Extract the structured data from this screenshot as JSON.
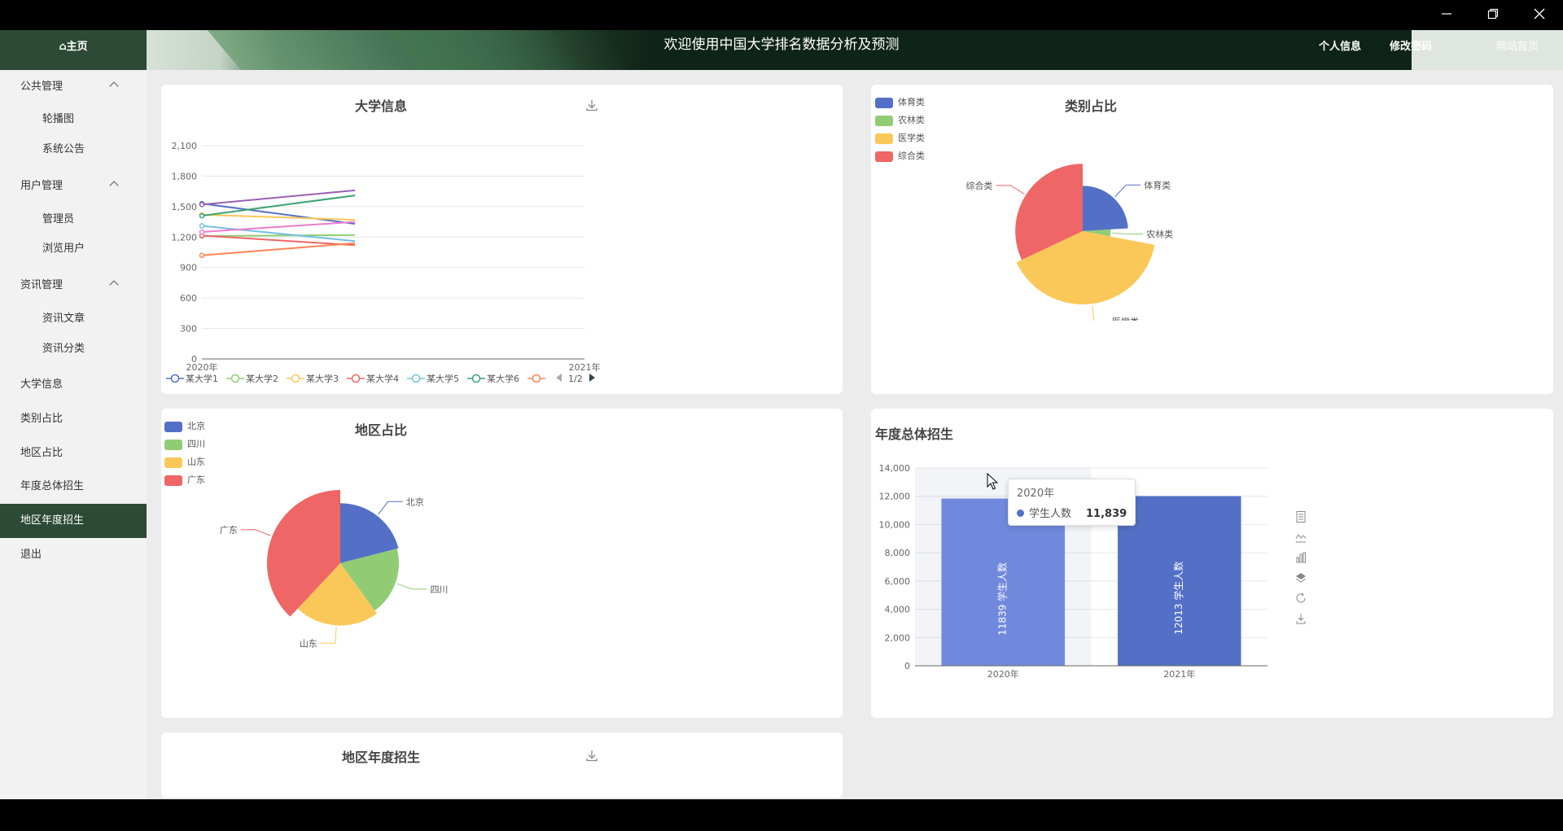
{
  "window": {
    "minimize_icon": "minimize-icon",
    "restore_icon": "restore-icon",
    "close_icon": "close-icon"
  },
  "header": {
    "home_label": "⌂主页",
    "title": "欢迎使用中国大学排名数据分析及预测",
    "links": [
      "个人信息",
      "修改密码",
      "网站首页"
    ]
  },
  "sidebar": {
    "groups": [
      {
        "label": "公共管理",
        "items": [
          "轮播图",
          "系统公告"
        ]
      },
      {
        "label": "用户管理",
        "items": [
          "管理员",
          "浏览用户"
        ]
      },
      {
        "label": "资讯管理",
        "items": [
          "资讯文章",
          "资讯分类"
        ]
      }
    ],
    "items": [
      "大学信息",
      "类别占比",
      "地区占比",
      "年度总体招生",
      "地区年度招生",
      "退出"
    ],
    "active": "地区年度招生"
  },
  "colors": {
    "brand": "#2d4a36",
    "blue": "#5470c6",
    "green": "#91cc75",
    "yellow": "#fac858",
    "red": "#ee6666",
    "cyan": "#73c0de",
    "teal": "#3ba272",
    "orange": "#fc8452",
    "purple": "#9a60b4",
    "pink": "#ea7ccc"
  },
  "cards": {
    "university": {
      "title": "大学信息",
      "pager": "1/2"
    },
    "category": {
      "title": "类别占比"
    },
    "region": {
      "title": "地区占比"
    },
    "enroll": {
      "title": "年度总体招生"
    },
    "region_enroll": {
      "title": "地区年度招生"
    }
  },
  "tooltip": {
    "title": "2020年",
    "series": "学生人数",
    "value": "11,839"
  },
  "chart_data": [
    {
      "id": "university_line",
      "type": "line",
      "title": "大学信息",
      "x": [
        "2020年",
        "2021年"
      ],
      "ylim": [
        0,
        2100
      ],
      "yticks": [
        "0",
        "300",
        "600",
        "900",
        "1,200",
        "1,500",
        "1,800",
        "2,100"
      ],
      "series": [
        {
          "name": "某大学1",
          "color": "#5470c6",
          "values": [
            1530,
            1330
          ]
        },
        {
          "name": "某大学2",
          "color": "#91cc75",
          "values": [
            1210,
            1220
          ]
        },
        {
          "name": "某大学3",
          "color": "#fac858",
          "values": [
            1420,
            1370
          ]
        },
        {
          "name": "某大学4",
          "color": "#ee6666",
          "values": [
            1215,
            1120
          ]
        },
        {
          "name": "某大学5",
          "color": "#73c0de",
          "values": [
            1310,
            1160
          ]
        },
        {
          "name": "某大学6",
          "color": "#3ba272",
          "values": [
            1410,
            1610
          ]
        },
        {
          "name": "",
          "color": "#fc8452",
          "values": [
            1020,
            1140
          ]
        },
        {
          "name": "",
          "color": "#9a60b4",
          "values": [
            1520,
            1660
          ]
        },
        {
          "name": "",
          "color": "#ea7ccc",
          "values": [
            1250,
            1350
          ]
        }
      ],
      "legend_visible_count": 7
    },
    {
      "id": "category_pie",
      "type": "pie",
      "title": "类别占比",
      "categories": [
        "体育类",
        "农林类",
        "医学类",
        "综合类"
      ],
      "values": [
        24,
        4,
        40,
        32
      ],
      "radii": [
        0.62,
        0.38,
        1.0,
        0.92
      ],
      "colors": [
        "#5470c6",
        "#91cc75",
        "#fac858",
        "#ee6666"
      ]
    },
    {
      "id": "region_pie",
      "type": "pie",
      "title": "地区占比",
      "categories": [
        "北京",
        "四川",
        "山东",
        "广东"
      ],
      "values": [
        21,
        19,
        22,
        38
      ],
      "radii": [
        0.82,
        0.8,
        0.85,
        1.0
      ],
      "colors": [
        "#5470c6",
        "#91cc75",
        "#fac858",
        "#ee6666"
      ]
    },
    {
      "id": "enroll_bar",
      "type": "bar",
      "title": "年度总体招生",
      "categories": [
        "2020年",
        "2021年"
      ],
      "series": [
        {
          "name": "学生人数",
          "values": [
            11839,
            12013
          ]
        }
      ],
      "ylim": [
        0,
        14000
      ],
      "yticks": [
        "0",
        "2,000",
        "4,000",
        "6,000",
        "8,000",
        "10,000",
        "12,000",
        "14,000"
      ],
      "data_labels": [
        "11839  学生人数",
        "12013  学生人数"
      ]
    }
  ]
}
